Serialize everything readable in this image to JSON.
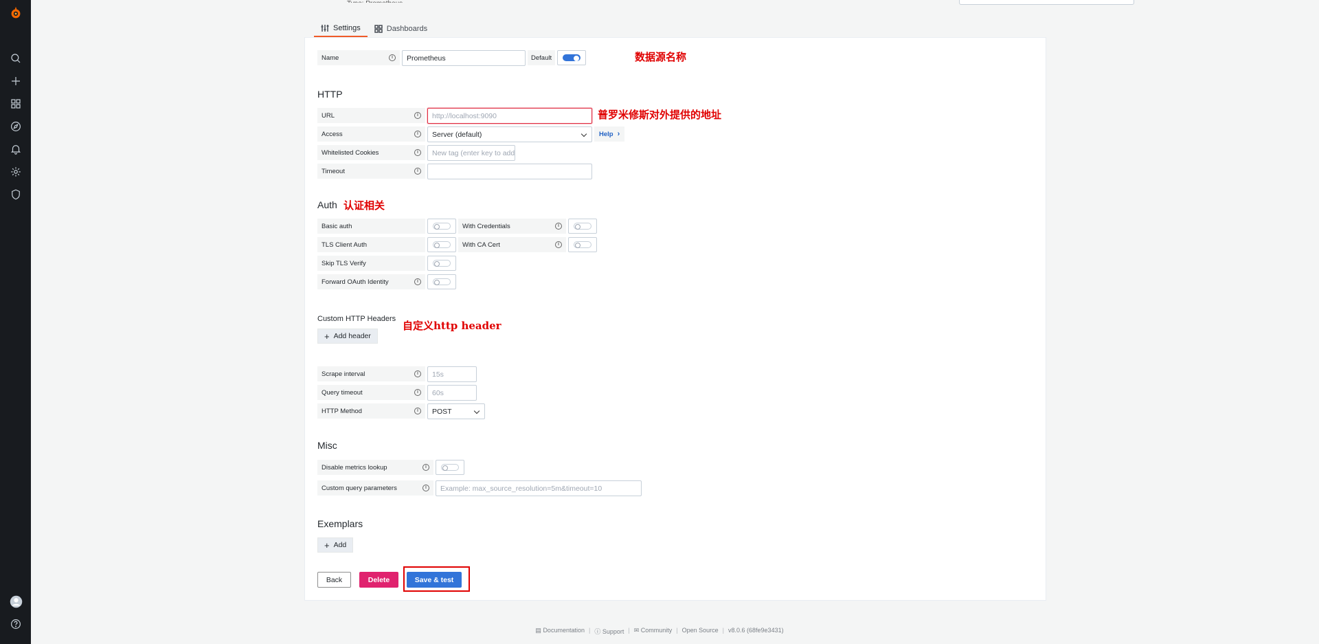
{
  "header": {
    "partial_text": "Type: Prometheus"
  },
  "tabs": [
    {
      "label": "Settings"
    },
    {
      "label": "Dashboards"
    }
  ],
  "name_row": {
    "label": "Name",
    "value": "Prometheus",
    "default_label": "Default",
    "default_on": true,
    "note": "数据源名称"
  },
  "http": {
    "title": "HTTP",
    "url_label": "URL",
    "url_placeholder": "http://localhost:9090",
    "url_note": "普罗米修斯对外提供的地址",
    "access_label": "Access",
    "access_value": "Server (default)",
    "help_label": "Help",
    "cookies_label": "Whitelisted Cookies",
    "cookies_placeholder": "New tag (enter key to add)",
    "timeout_label": "Timeout",
    "timeout_value": ""
  },
  "auth": {
    "title": "Auth",
    "note": "认证相关",
    "basic_auth": "Basic auth",
    "with_credentials": "With Credentials",
    "tls_client_auth": "TLS Client Auth",
    "with_ca_cert": "With CA Cert",
    "skip_tls": "Skip TLS Verify",
    "forward_oauth": "Forward OAuth Identity"
  },
  "custom_headers": {
    "title": "Custom HTTP Headers",
    "add_label": "Add header",
    "note": "自定义http header"
  },
  "prom": {
    "scrape_label": "Scrape interval",
    "scrape_placeholder": "15s",
    "query_timeout_label": "Query timeout",
    "query_timeout_placeholder": "60s",
    "method_label": "HTTP Method",
    "method_value": "POST"
  },
  "misc": {
    "title": "Misc",
    "disable_lookup": "Disable metrics lookup",
    "custom_params_label": "Custom query parameters",
    "custom_params_placeholder": "Example: max_source_resolution=5m&timeout=10"
  },
  "exemplars": {
    "title": "Exemplars",
    "add_label": "Add"
  },
  "actions": {
    "back": "Back",
    "delete": "Delete",
    "save": "Save & test"
  },
  "footer": {
    "documentation": "Documentation",
    "support": "Support",
    "community": "Community",
    "open_source": "Open Source",
    "version": "v8.0.6 (68fe9e3431)"
  },
  "colors": {
    "primary": "#3274d9",
    "danger": "#e0226e",
    "accent": "#f05a28",
    "annotation": "#e00000",
    "sidebar": "#181b1f"
  }
}
